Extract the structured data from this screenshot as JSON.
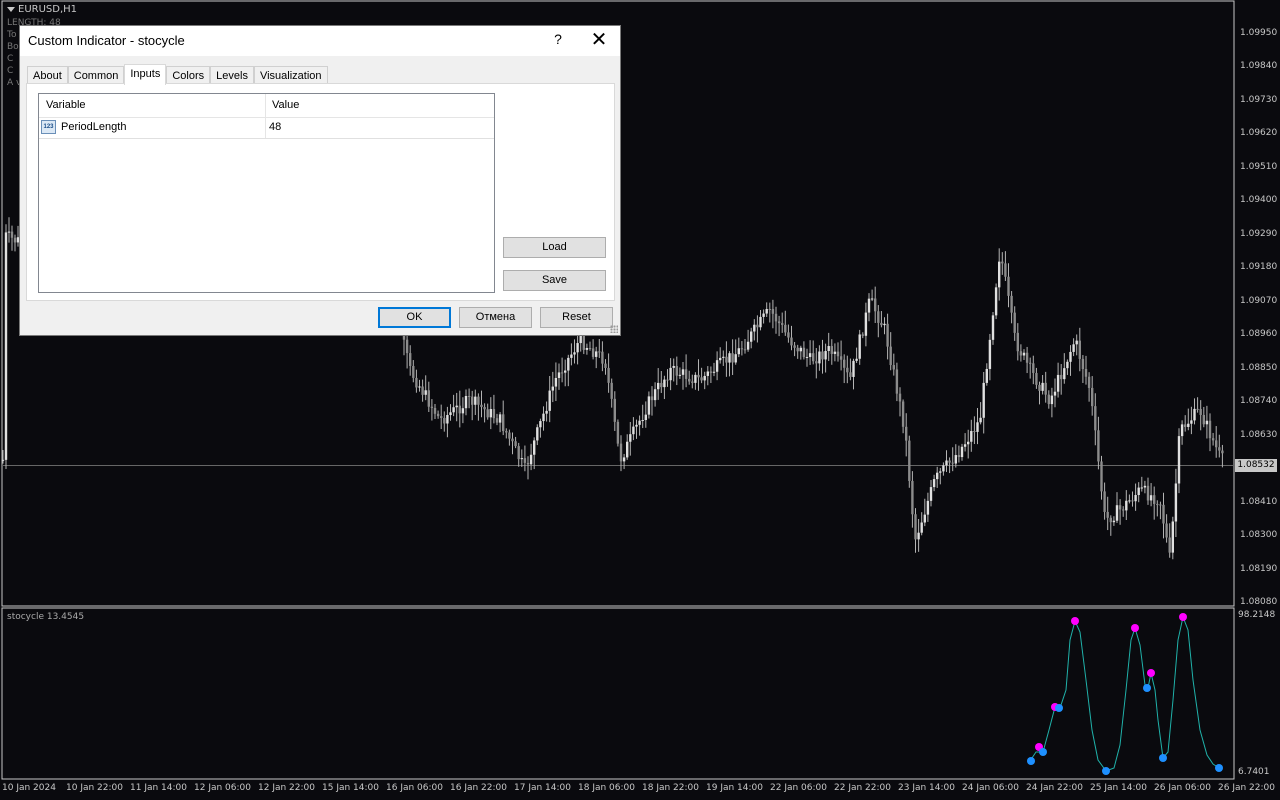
{
  "chart": {
    "symbol": "EURUSD,H1",
    "info_lines": [
      "LENGTH: 48",
      "To",
      "Bo",
      "C",
      "C",
      "A v"
    ],
    "price_levels": [
      "1.09950",
      "1.09840",
      "1.09730",
      "1.09620",
      "1.09510",
      "1.09400",
      "1.09290",
      "1.09180",
      "1.09070",
      "1.08960",
      "1.08850",
      "1.08740",
      "1.08630",
      "1.08410",
      "1.08300",
      "1.08190",
      "1.08080"
    ],
    "current_price": "1.08532",
    "time_labels": [
      "10 Jan 2024",
      "10 Jan 22:00",
      "11 Jan 14:00",
      "12 Jan 06:00",
      "12 Jan 22:00",
      "15 Jan 14:00",
      "16 Jan 06:00",
      "16 Jan 22:00",
      "17 Jan 14:00",
      "18 Jan 06:00",
      "18 Jan 22:00",
      "19 Jan 14:00",
      "22 Jan 06:00",
      "22 Jan 22:00",
      "23 Jan 14:00",
      "24 Jan 06:00",
      "24 Jan 22:00",
      "25 Jan 14:00",
      "26 Jan 06:00",
      "26 Jan 22:00"
    ],
    "colors": {
      "background": "#0a0a0e",
      "candle": "#b4b4b4",
      "indicator_line": "#20b2aa",
      "dot_high": "#ff00ff",
      "dot_low": "#1e90ff"
    }
  },
  "indicator": {
    "label": "stocycle 13.4545",
    "max_label": "98.2148",
    "min_label": "6.7401"
  },
  "dialog": {
    "title": "Custom Indicator - stocycle",
    "help": "?",
    "close": "✕",
    "tabs": [
      "About",
      "Common",
      "Inputs",
      "Colors",
      "Levels",
      "Visualization"
    ],
    "active_tab": "Inputs",
    "table": {
      "headers": [
        "Variable",
        "Value"
      ],
      "rows": [
        {
          "icon": "123",
          "variable": "PeriodLength",
          "value": "48"
        }
      ]
    },
    "buttons": {
      "load": "Load",
      "save": "Save",
      "ok": "OK",
      "cancel": "Отмена",
      "reset": "Reset"
    }
  }
}
